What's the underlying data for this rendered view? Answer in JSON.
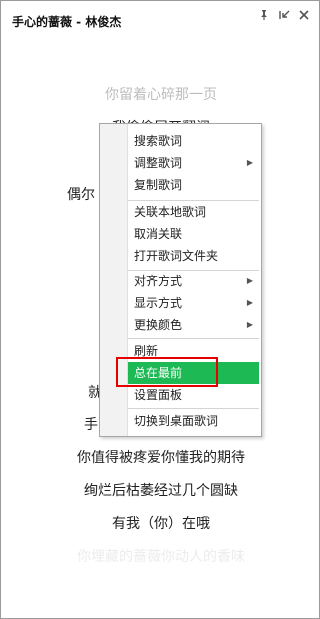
{
  "window": {
    "title": "手心的蔷薇 - 林俊杰",
    "buttons": [
      "pin-icon",
      "minimize-icon",
      "close-icon"
    ]
  },
  "lyrics": [
    {
      "text": "你留着心碎那一页",
      "style": "faded"
    },
    {
      "text": "我偷偷展开翻阅",
      "style": "normal"
    },
    {
      "text": "偶尔",
      "style": "normal"
    },
    {
      "text": "就",
      "style": "normal"
    },
    {
      "text": "手",
      "style": "normal"
    },
    {
      "text": "你值得被疼爱你懂我的期待",
      "style": "normal"
    },
    {
      "text": "绚烂后枯萎经过几个圆缺",
      "style": "normal"
    },
    {
      "text": "有我（你）在哦",
      "style": "normal"
    },
    {
      "text": "你埋藏的蔷薇你动人的香味",
      "style": "ghost"
    }
  ],
  "context_menu": {
    "items": [
      {
        "label": "搜索歌词",
        "submenu": false
      },
      {
        "label": "调整歌词",
        "submenu": true
      },
      {
        "label": "复制歌词",
        "submenu": false
      },
      {
        "label": "关联本地歌词",
        "submenu": false
      },
      {
        "label": "取消关联",
        "submenu": false
      },
      {
        "label": "打开歌词文件夹",
        "submenu": false
      },
      {
        "label": "对齐方式",
        "submenu": true
      },
      {
        "label": "显示方式",
        "submenu": true
      },
      {
        "label": "更换颜色",
        "submenu": true
      },
      {
        "label": "刷新",
        "submenu": false
      },
      {
        "label": "总在最前",
        "submenu": false,
        "highlighted": true
      },
      {
        "label": "设置面板",
        "submenu": false
      },
      {
        "label": "切换到桌面歌词",
        "submenu": false
      }
    ],
    "highlight_color": "#1db954",
    "annotation_color": "#e60000",
    "submenu_arrow": "▶"
  }
}
